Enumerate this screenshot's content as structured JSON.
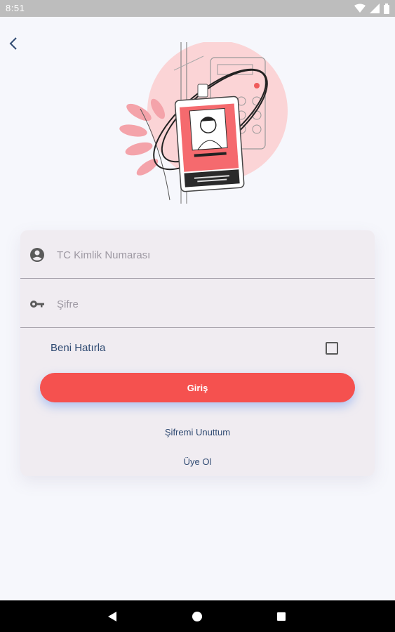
{
  "status_bar": {
    "time": "8:51"
  },
  "form": {
    "tc_placeholder": "TC Kimlik Numarası",
    "password_placeholder": "Şifre",
    "remember_label": "Beni Hatırla",
    "remember_checked": false,
    "login_label": "Giriş",
    "forgot_label": "Şifremi Unuttum",
    "register_label": "Üye Ol"
  },
  "colors": {
    "accent": "#f5514f",
    "link": "#2f4a72",
    "card": "#f0ecf1",
    "background": "#f6f7fc"
  },
  "icons": {
    "back": "chevron-left-icon",
    "user": "account-circle-icon",
    "key": "key-icon",
    "checkbox": "checkbox-unchecked-icon"
  }
}
